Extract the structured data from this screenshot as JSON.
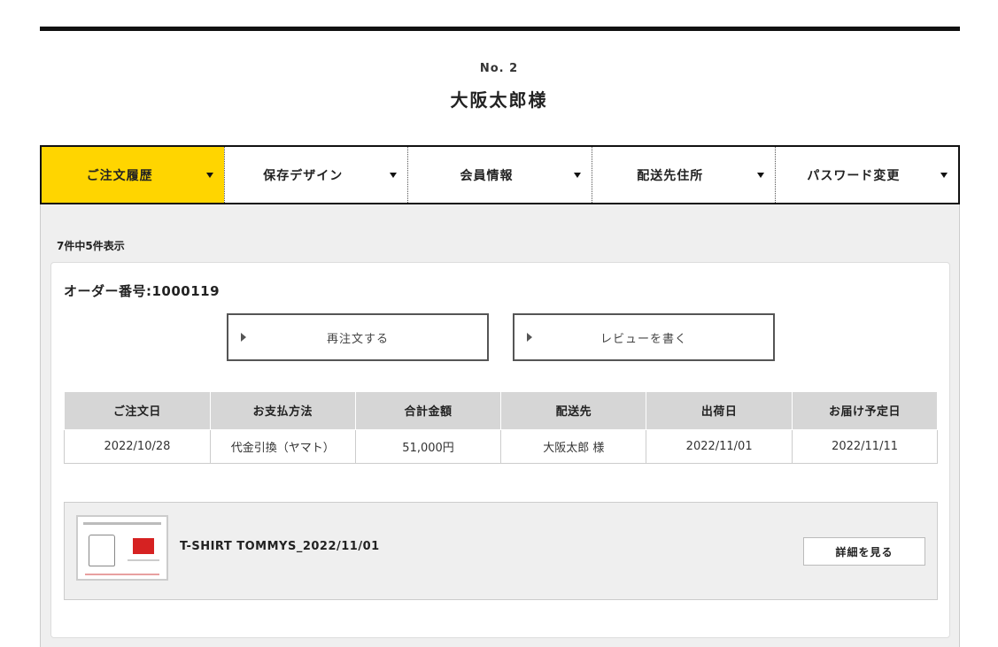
{
  "member": {
    "number": "No. 2",
    "name": "大阪太郎様"
  },
  "tabs": [
    {
      "label": "ご注文履歴",
      "active": true
    },
    {
      "label": "保存デザイン",
      "active": false
    },
    {
      "label": "会員情報",
      "active": false
    },
    {
      "label": "配送先住所",
      "active": false
    },
    {
      "label": "パスワード変更",
      "active": false
    }
  ],
  "colors": {
    "accent": "#ffd500",
    "panel_bg": "#efefef",
    "header_bg": "#d6d6d6"
  },
  "order_list": {
    "count_text": "7件中5件表示"
  },
  "order": {
    "order_no": "オーダー番号:1000119",
    "reorder_label": "再注文する",
    "review_label": "レビューを書く",
    "table": {
      "headers": [
        "ご注文日",
        "お支払方法",
        "合計金額",
        "配送先",
        "出荷日",
        "お届け予定日"
      ],
      "row": [
        "2022/10/28",
        "代金引換（ヤマト）",
        "51,000円",
        "大阪太郎 様",
        "2022/11/01",
        "2022/11/11"
      ]
    },
    "item": {
      "name": "T-SHIRT TOMMYS_2022/11/01",
      "detail_label": "詳細を見る"
    }
  }
}
